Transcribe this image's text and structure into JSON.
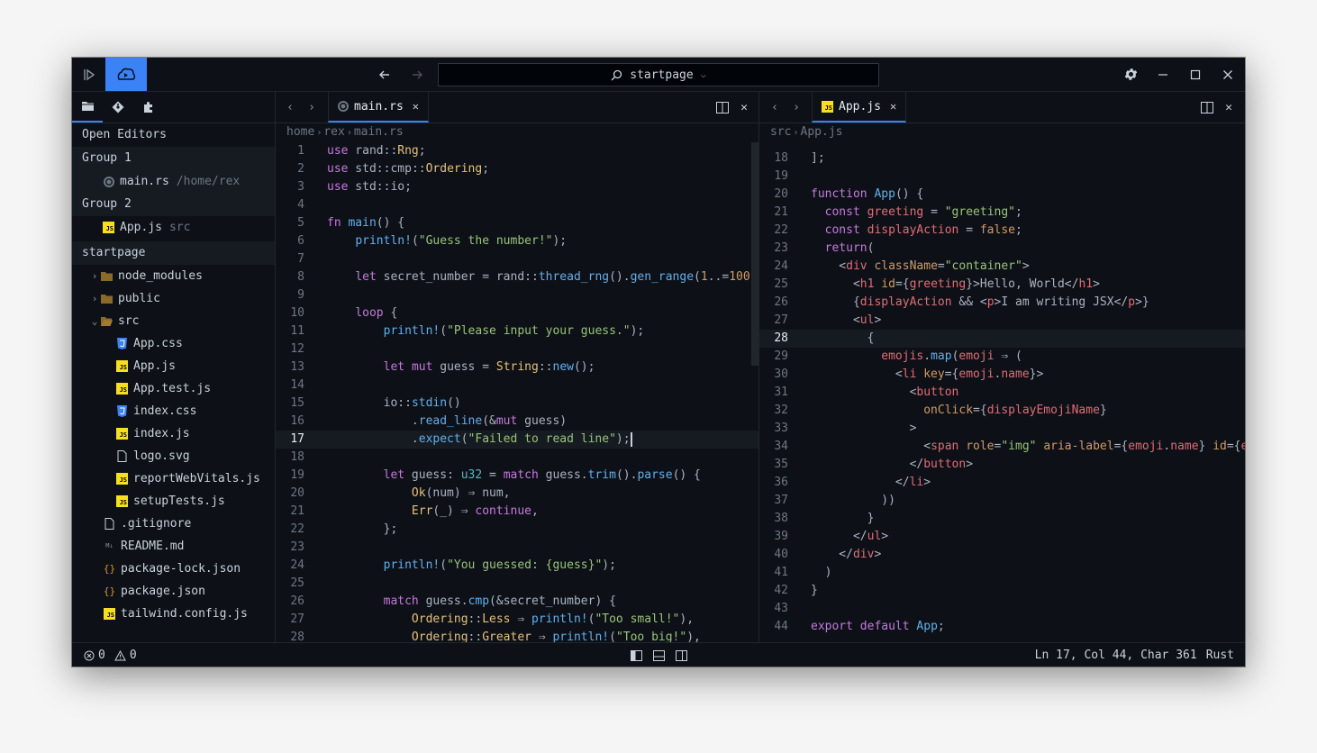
{
  "titlebar": {
    "project": "startpage"
  },
  "sidebar": {
    "open_editors_label": "Open Editors",
    "groups": [
      {
        "label": "Group 1",
        "file": "main.rs",
        "path": "/home/rex"
      },
      {
        "label": "Group 2",
        "file": "App.js",
        "path": "src"
      }
    ],
    "project_label": "startpage",
    "tree": {
      "node_modules": "node_modules",
      "public": "public",
      "src": "src",
      "src_files": [
        "App.css",
        "App.js",
        "App.test.js",
        "index.css",
        "index.js",
        "logo.svg",
        "reportWebVitals.js",
        "setupTests.js"
      ],
      "root_files": [
        ".gitignore",
        "README.md",
        "package-lock.json",
        "package.json",
        "tailwind.config.js"
      ]
    }
  },
  "left_pane": {
    "tab": "main.rs",
    "breadcrumb": [
      "home",
      "rex",
      "main.rs"
    ],
    "current_line": 17,
    "lines": [
      {
        "n": "1"
      },
      {
        "n": "2"
      },
      {
        "n": "3"
      },
      {
        "n": "4"
      },
      {
        "n": "5"
      },
      {
        "n": "6"
      },
      {
        "n": "7"
      },
      {
        "n": "8"
      },
      {
        "n": "9"
      },
      {
        "n": "10"
      },
      {
        "n": "11"
      },
      {
        "n": "12"
      },
      {
        "n": "13"
      },
      {
        "n": "14"
      },
      {
        "n": "15"
      },
      {
        "n": "16"
      },
      {
        "n": "17"
      },
      {
        "n": "18"
      },
      {
        "n": "19"
      },
      {
        "n": "20"
      },
      {
        "n": "21"
      },
      {
        "n": "22"
      },
      {
        "n": "23"
      },
      {
        "n": "24"
      },
      {
        "n": "25"
      },
      {
        "n": "26"
      },
      {
        "n": "27"
      },
      {
        "n": "28"
      }
    ],
    "code": [
      [
        [
          "k",
          "use"
        ],
        [
          "p",
          " rand"
        ],
        [
          "p",
          "::"
        ],
        [
          "t",
          "Rng"
        ],
        [
          "p",
          ";"
        ]
      ],
      [
        [
          "k",
          "use"
        ],
        [
          "p",
          " std"
        ],
        [
          "p",
          "::"
        ],
        [
          "p",
          "cmp"
        ],
        [
          "p",
          "::"
        ],
        [
          "t",
          "Ordering"
        ],
        [
          "p",
          ";"
        ]
      ],
      [
        [
          "k",
          "use"
        ],
        [
          "p",
          " std"
        ],
        [
          "p",
          "::"
        ],
        [
          "p",
          "io"
        ],
        [
          "p",
          ";"
        ]
      ],
      [],
      [
        [
          "k",
          "fn"
        ],
        [
          "p",
          " "
        ],
        [
          "f",
          "main"
        ],
        [
          "p",
          "() {"
        ]
      ],
      [
        [
          "p",
          "    "
        ],
        [
          "f",
          "println!"
        ],
        [
          "p",
          "("
        ],
        [
          "s",
          "\"Guess the number!\""
        ],
        [
          "p",
          ");"
        ]
      ],
      [],
      [
        [
          "p",
          "    "
        ],
        [
          "k",
          "let"
        ],
        [
          "p",
          " secret_number = rand"
        ],
        [
          "p",
          "::"
        ],
        [
          "f",
          "thread_rng"
        ],
        [
          "p",
          "()."
        ],
        [
          "f",
          "gen_range"
        ],
        [
          "p",
          "("
        ],
        [
          "n",
          "1"
        ],
        [
          "p",
          "..="
        ],
        [
          "n",
          "100"
        ],
        [
          "p",
          ");"
        ]
      ],
      [],
      [
        [
          "p",
          "    "
        ],
        [
          "k",
          "loop"
        ],
        [
          "p",
          " {"
        ]
      ],
      [
        [
          "p",
          "        "
        ],
        [
          "f",
          "println!"
        ],
        [
          "p",
          "("
        ],
        [
          "s",
          "\"Please input your guess.\""
        ],
        [
          "p",
          ");"
        ]
      ],
      [],
      [
        [
          "p",
          "        "
        ],
        [
          "k",
          "let"
        ],
        [
          "p",
          " "
        ],
        [
          "k",
          "mut"
        ],
        [
          "p",
          " guess = "
        ],
        [
          "t",
          "String"
        ],
        [
          "p",
          "::"
        ],
        [
          "f",
          "new"
        ],
        [
          "p",
          "();"
        ]
      ],
      [],
      [
        [
          "p",
          "        io"
        ],
        [
          "p",
          "::"
        ],
        [
          "f",
          "stdin"
        ],
        [
          "p",
          "()"
        ]
      ],
      [
        [
          "p",
          "            ."
        ],
        [
          "f",
          "read_line"
        ],
        [
          "p",
          "(&"
        ],
        [
          "k",
          "mut"
        ],
        [
          "p",
          " guess)"
        ]
      ],
      [
        [
          "p",
          "            ."
        ],
        [
          "f",
          "expect"
        ],
        [
          "p",
          "("
        ],
        [
          "s",
          "\"Failed to read line\""
        ],
        [
          "p",
          ");"
        ],
        [
          "cursor",
          ""
        ]
      ],
      [],
      [
        [
          "p",
          "        "
        ],
        [
          "k",
          "let"
        ],
        [
          "p",
          " guess: "
        ],
        [
          "m",
          "u32"
        ],
        [
          "p",
          " = "
        ],
        [
          "k",
          "match"
        ],
        [
          "p",
          " guess."
        ],
        [
          "f",
          "trim"
        ],
        [
          "p",
          "()."
        ],
        [
          "f",
          "parse"
        ],
        [
          "p",
          "() {"
        ]
      ],
      [
        [
          "p",
          "            "
        ],
        [
          "t",
          "Ok"
        ],
        [
          "p",
          "(num) ⇒ num,"
        ]
      ],
      [
        [
          "p",
          "            "
        ],
        [
          "t",
          "Err"
        ],
        [
          "p",
          "(_) ⇒ "
        ],
        [
          "k",
          "continue"
        ],
        [
          "p",
          ","
        ]
      ],
      [
        [
          "p",
          "        };"
        ]
      ],
      [],
      [
        [
          "p",
          "        "
        ],
        [
          "f",
          "println!"
        ],
        [
          "p",
          "("
        ],
        [
          "s",
          "\"You guessed: {guess}\""
        ],
        [
          "p",
          ");"
        ]
      ],
      [],
      [
        [
          "p",
          "        "
        ],
        [
          "k",
          "match"
        ],
        [
          "p",
          " guess."
        ],
        [
          "f",
          "cmp"
        ],
        [
          "p",
          "(&secret_number) {"
        ]
      ],
      [
        [
          "p",
          "            "
        ],
        [
          "t",
          "Ordering"
        ],
        [
          "p",
          "::"
        ],
        [
          "t",
          "Less"
        ],
        [
          "p",
          " ⇒ "
        ],
        [
          "f",
          "println!"
        ],
        [
          "p",
          "("
        ],
        [
          "s",
          "\"Too small!\""
        ],
        [
          "p",
          "),"
        ]
      ],
      [
        [
          "p",
          "            "
        ],
        [
          "t",
          "Ordering"
        ],
        [
          "p",
          "::"
        ],
        [
          "t",
          "Greater"
        ],
        [
          "p",
          " ⇒ "
        ],
        [
          "f",
          "println!"
        ],
        [
          "p",
          "("
        ],
        [
          "s",
          "\"Too big!\""
        ],
        [
          "p",
          "),"
        ]
      ]
    ]
  },
  "right_pane": {
    "tab": "App.js",
    "breadcrumb": [
      "src",
      "App.js"
    ],
    "current_line": 28,
    "lines": [
      {
        "n": "18"
      },
      {
        "n": "19"
      },
      {
        "n": "20"
      },
      {
        "n": "21"
      },
      {
        "n": "22"
      },
      {
        "n": "23"
      },
      {
        "n": "24"
      },
      {
        "n": "25"
      },
      {
        "n": "26"
      },
      {
        "n": "27"
      },
      {
        "n": "28"
      },
      {
        "n": "29"
      },
      {
        "n": "30"
      },
      {
        "n": "31"
      },
      {
        "n": "32"
      },
      {
        "n": "33"
      },
      {
        "n": "34"
      },
      {
        "n": "35"
      },
      {
        "n": "36"
      },
      {
        "n": "37"
      },
      {
        "n": "38"
      },
      {
        "n": "39"
      },
      {
        "n": "40"
      },
      {
        "n": "41"
      },
      {
        "n": "42"
      },
      {
        "n": "43"
      },
      {
        "n": "44"
      }
    ],
    "code": [
      [
        [
          "p",
          "];"
        ]
      ],
      [],
      [
        [
          "k",
          "function"
        ],
        [
          "p",
          " "
        ],
        [
          "f",
          "App"
        ],
        [
          "p",
          "() {"
        ]
      ],
      [
        [
          "p",
          "  "
        ],
        [
          "k",
          "const"
        ],
        [
          "p",
          " "
        ],
        [
          "r",
          "greeting"
        ],
        [
          "p",
          " = "
        ],
        [
          "s",
          "\"greeting\""
        ],
        [
          "p",
          ";"
        ]
      ],
      [
        [
          "p",
          "  "
        ],
        [
          "k",
          "const"
        ],
        [
          "p",
          " "
        ],
        [
          "r",
          "displayAction"
        ],
        [
          "p",
          " = "
        ],
        [
          "n",
          "false"
        ],
        [
          "p",
          ";"
        ]
      ],
      [
        [
          "p",
          "  "
        ],
        [
          "k",
          "return"
        ],
        [
          "p",
          "("
        ]
      ],
      [
        [
          "p",
          "    <"
        ],
        [
          "r",
          "div"
        ],
        [
          "p",
          " "
        ],
        [
          "n",
          "className"
        ],
        [
          "p",
          "="
        ],
        [
          "s",
          "\"container\""
        ],
        [
          "p",
          ">"
        ]
      ],
      [
        [
          "p",
          "      <"
        ],
        [
          "r",
          "h1"
        ],
        [
          "p",
          " "
        ],
        [
          "n",
          "id"
        ],
        [
          "p",
          "={"
        ],
        [
          "r",
          "greeting"
        ],
        [
          "p",
          "}>Hello, World</"
        ],
        [
          "r",
          "h1"
        ],
        [
          "p",
          ">"
        ]
      ],
      [
        [
          "p",
          "      {"
        ],
        [
          "r",
          "displayAction"
        ],
        [
          "p",
          " && <"
        ],
        [
          "r",
          "p"
        ],
        [
          "p",
          ">I am writing JSX</"
        ],
        [
          "r",
          "p"
        ],
        [
          "p",
          ">}"
        ]
      ],
      [
        [
          "p",
          "      <"
        ],
        [
          "r",
          "ul"
        ],
        [
          "p",
          ">"
        ]
      ],
      [
        [
          "p",
          "        {"
        ]
      ],
      [
        [
          "p",
          "          "
        ],
        [
          "r",
          "emojis"
        ],
        [
          "p",
          "."
        ],
        [
          "f",
          "map"
        ],
        [
          "p",
          "("
        ],
        [
          "r",
          "emoji"
        ],
        [
          "p",
          " ⇒ ("
        ]
      ],
      [
        [
          "p",
          "            <"
        ],
        [
          "r",
          "li"
        ],
        [
          "p",
          " "
        ],
        [
          "n",
          "key"
        ],
        [
          "p",
          "={"
        ],
        [
          "r",
          "emoji"
        ],
        [
          "p",
          "."
        ],
        [
          "r",
          "name"
        ],
        [
          "p",
          "}>"
        ]
      ],
      [
        [
          "p",
          "              <"
        ],
        [
          "r",
          "button"
        ]
      ],
      [
        [
          "p",
          "                "
        ],
        [
          "n",
          "onClick"
        ],
        [
          "p",
          "={"
        ],
        [
          "r",
          "displayEmojiName"
        ],
        [
          "p",
          "}"
        ]
      ],
      [
        [
          "p",
          "              >"
        ]
      ],
      [
        [
          "p",
          "                <"
        ],
        [
          "r",
          "span"
        ],
        [
          "p",
          " "
        ],
        [
          "n",
          "role"
        ],
        [
          "p",
          "="
        ],
        [
          "s",
          "\"img\""
        ],
        [
          "p",
          " "
        ],
        [
          "n",
          "aria-label"
        ],
        [
          "p",
          "={"
        ],
        [
          "r",
          "emoji"
        ],
        [
          "p",
          "."
        ],
        [
          "r",
          "name"
        ],
        [
          "p",
          "} "
        ],
        [
          "n",
          "id"
        ],
        [
          "p",
          "={"
        ],
        [
          "r",
          "emoji"
        ],
        [
          "p",
          "."
        ],
        [
          "r",
          "name"
        ],
        [
          "p",
          "}>"
        ]
      ],
      [
        [
          "p",
          "              </"
        ],
        [
          "r",
          "button"
        ],
        [
          "p",
          ">"
        ]
      ],
      [
        [
          "p",
          "            </"
        ],
        [
          "r",
          "li"
        ],
        [
          "p",
          ">"
        ]
      ],
      [
        [
          "p",
          "          ))"
        ]
      ],
      [
        [
          "p",
          "        }"
        ]
      ],
      [
        [
          "p",
          "      </"
        ],
        [
          "r",
          "ul"
        ],
        [
          "p",
          ">"
        ]
      ],
      [
        [
          "p",
          "    </"
        ],
        [
          "r",
          "div"
        ],
        [
          "p",
          ">"
        ]
      ],
      [
        [
          "p",
          "  )"
        ]
      ],
      [
        [
          "p",
          "}"
        ]
      ],
      [],
      [
        [
          "k",
          "export"
        ],
        [
          "p",
          " "
        ],
        [
          "k",
          "default"
        ],
        [
          "p",
          " "
        ],
        [
          "f",
          "App"
        ],
        [
          "p",
          ";"
        ]
      ]
    ]
  },
  "statusbar": {
    "errors": "0",
    "warnings": "0",
    "position": "Ln 17, Col 44, Char 361",
    "language": "Rust"
  },
  "colors": {
    "accent": "#3b82f6",
    "background": "#0d1117"
  }
}
